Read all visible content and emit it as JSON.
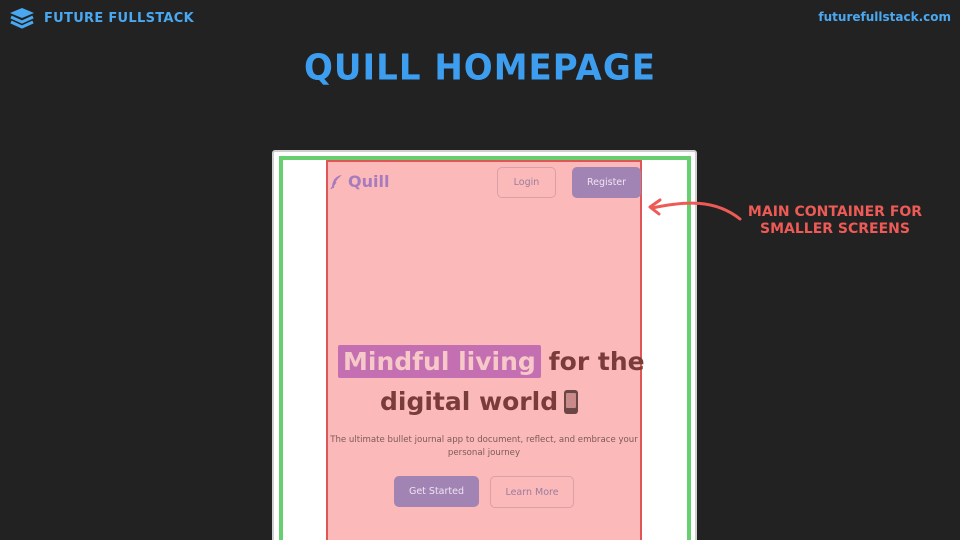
{
  "brand": {
    "name": "FUTURE FULLSTACK",
    "url": "futurefullstack.com"
  },
  "slide": {
    "title": "QUILL HOMEPAGE"
  },
  "annotation": {
    "line1": "MAIN CONTAINER FOR",
    "line2": "SMALLER SCREENS"
  },
  "quill_page": {
    "logo_text": "Quill",
    "nav": {
      "login": "Login",
      "register": "Register"
    },
    "hero": {
      "highlight": "Mindful living",
      "rest_line1": "for the",
      "line2": "digital world",
      "icon": "mobile-phone-icon"
    },
    "subtitle_line1": "The ultimate bullet journal app to document, reflect, and embrace your",
    "subtitle_line2": "personal journey",
    "cta": {
      "primary": "Get Started",
      "secondary": "Learn More"
    }
  },
  "colors": {
    "background": "#222222",
    "brand_blue": "#4aa8f0",
    "green_outline": "#67cf6f",
    "red_outline": "#e05656",
    "container_fill": "#fbb9b9",
    "annotation": "#ee5a55"
  }
}
